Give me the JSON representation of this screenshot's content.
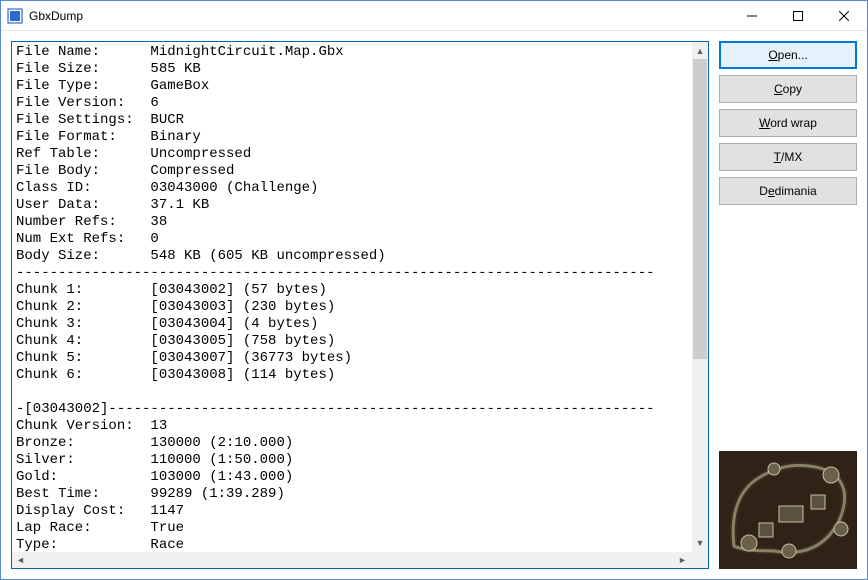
{
  "window": {
    "title": "GbxDump"
  },
  "buttons": {
    "open": {
      "prefix": "",
      "ul": "O",
      "suffix": "pen..."
    },
    "copy": {
      "prefix": "",
      "ul": "C",
      "suffix": "opy"
    },
    "wrap": {
      "prefix": "",
      "ul": "W",
      "suffix": "ord wrap"
    },
    "tmx": {
      "prefix": "",
      "ul": "T",
      "suffix": "/MX"
    },
    "dedimania": {
      "prefix": "D",
      "ul": "e",
      "suffix": "dimania"
    }
  },
  "file": {
    "File Name": "MidnightCircuit.Map.Gbx",
    "File Size": "585 KB",
    "File Type": "GameBox",
    "File Version": "6",
    "File Settings": "BUCR",
    "File Format": "Binary",
    "Ref Table": "Uncompressed",
    "File Body": "Compressed",
    "Class ID": "03043000 (Challenge)",
    "User Data": "37.1 KB",
    "Number Refs": "38",
    "Num Ext Refs": "0",
    "Body Size": "548 KB (605 KB uncompressed)"
  },
  "divider1": "----------------------------------------------------------------------------",
  "chunks": [
    {
      "k": "Chunk 1",
      "v": "[03043002] (57 bytes)"
    },
    {
      "k": "Chunk 2",
      "v": "[03043003] (230 bytes)"
    },
    {
      "k": "Chunk 3",
      "v": "[03043004] (4 bytes)"
    },
    {
      "k": "Chunk 4",
      "v": "[03043005] (758 bytes)"
    },
    {
      "k": "Chunk 5",
      "v": "[03043007] (36773 bytes)"
    },
    {
      "k": "Chunk 6",
      "v": "[03043008] (114 bytes)"
    }
  ],
  "section_header": "-[03043002]-----------------------------------------------------------------",
  "section": {
    "Chunk Version": "13",
    "Bronze": "130000 (2:10.000)",
    "Silver": "110000 (1:50.000)",
    "Gold": "103000 (1:43.000)",
    "Best Time": "99289 (1:39.289)",
    "Display Cost": "1147",
    "Lap Race": "True",
    "Type": "Race"
  }
}
